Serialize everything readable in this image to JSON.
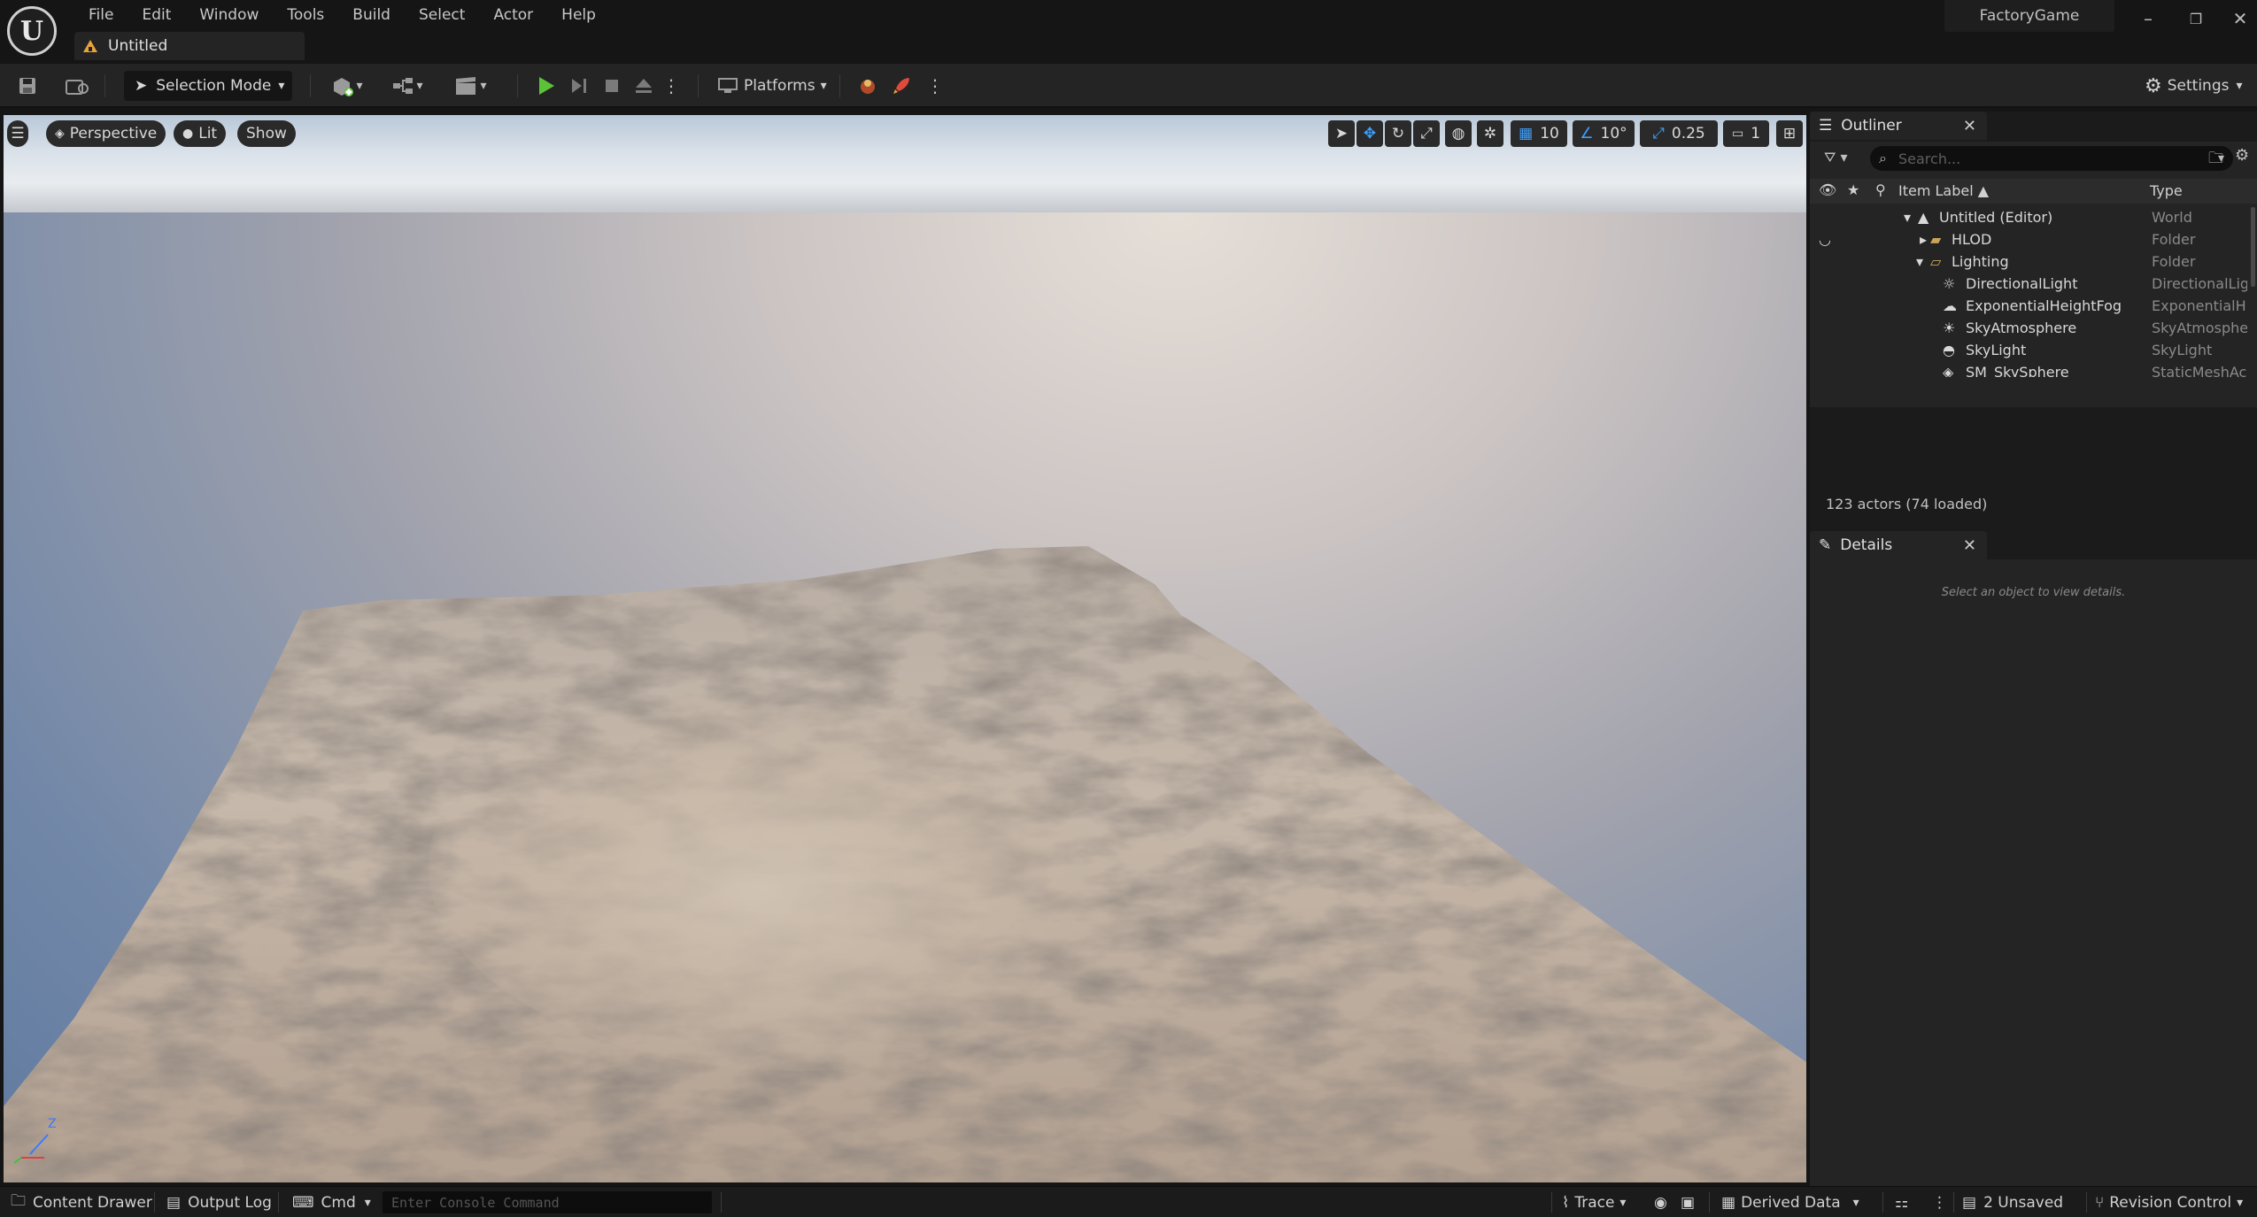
{
  "window": {
    "project_name": "FactoryGame",
    "document_tab": "Untitled"
  },
  "menu": [
    "File",
    "Edit",
    "Window",
    "Tools",
    "Build",
    "Select",
    "Actor",
    "Help"
  ],
  "toolbar": {
    "selection_mode": "Selection Mode",
    "platforms": "Platforms",
    "settings": "Settings"
  },
  "viewport": {
    "perspective": "Perspective",
    "lit": "Lit",
    "show": "Show",
    "grid_snap": "10",
    "rotation_snap": "10°",
    "scale_snap": "0.25",
    "camera_speed": "1",
    "axis_label": "Z"
  },
  "outliner": {
    "title": "Outliner",
    "search_placeholder": "Search...",
    "col_label": "Item Label ▲",
    "col_type": "Type",
    "rows": [
      {
        "label": "Untitled (Editor)",
        "type": "World"
      },
      {
        "label": "HLOD",
        "type": "Folder"
      },
      {
        "label": "Lighting",
        "type": "Folder"
      },
      {
        "label": "DirectionalLight",
        "type": "DirectionalLig"
      },
      {
        "label": "ExponentialHeightFog",
        "type": "ExponentialH"
      },
      {
        "label": "SkyAtmosphere",
        "type": "SkyAtmosphe"
      },
      {
        "label": "SkyLight",
        "type": "SkyLight"
      },
      {
        "label": "SM_SkySphere",
        "type": "StaticMeshAc"
      }
    ],
    "actor_count": "123 actors (74 loaded)"
  },
  "details": {
    "title": "Details",
    "empty_text": "Select an object to view details."
  },
  "statusbar": {
    "content_drawer": "Content Drawer",
    "output_log": "Output Log",
    "cmd": "Cmd",
    "console_placeholder": "Enter Console Command",
    "trace": "Trace",
    "derived_data": "Derived Data",
    "unsaved": "2 Unsaved",
    "revision_control": "Revision Control"
  },
  "colors": {
    "accent_blue": "#3ea0ff",
    "play_green": "#5cc23a",
    "folder_yellow": "#c9a45a"
  }
}
